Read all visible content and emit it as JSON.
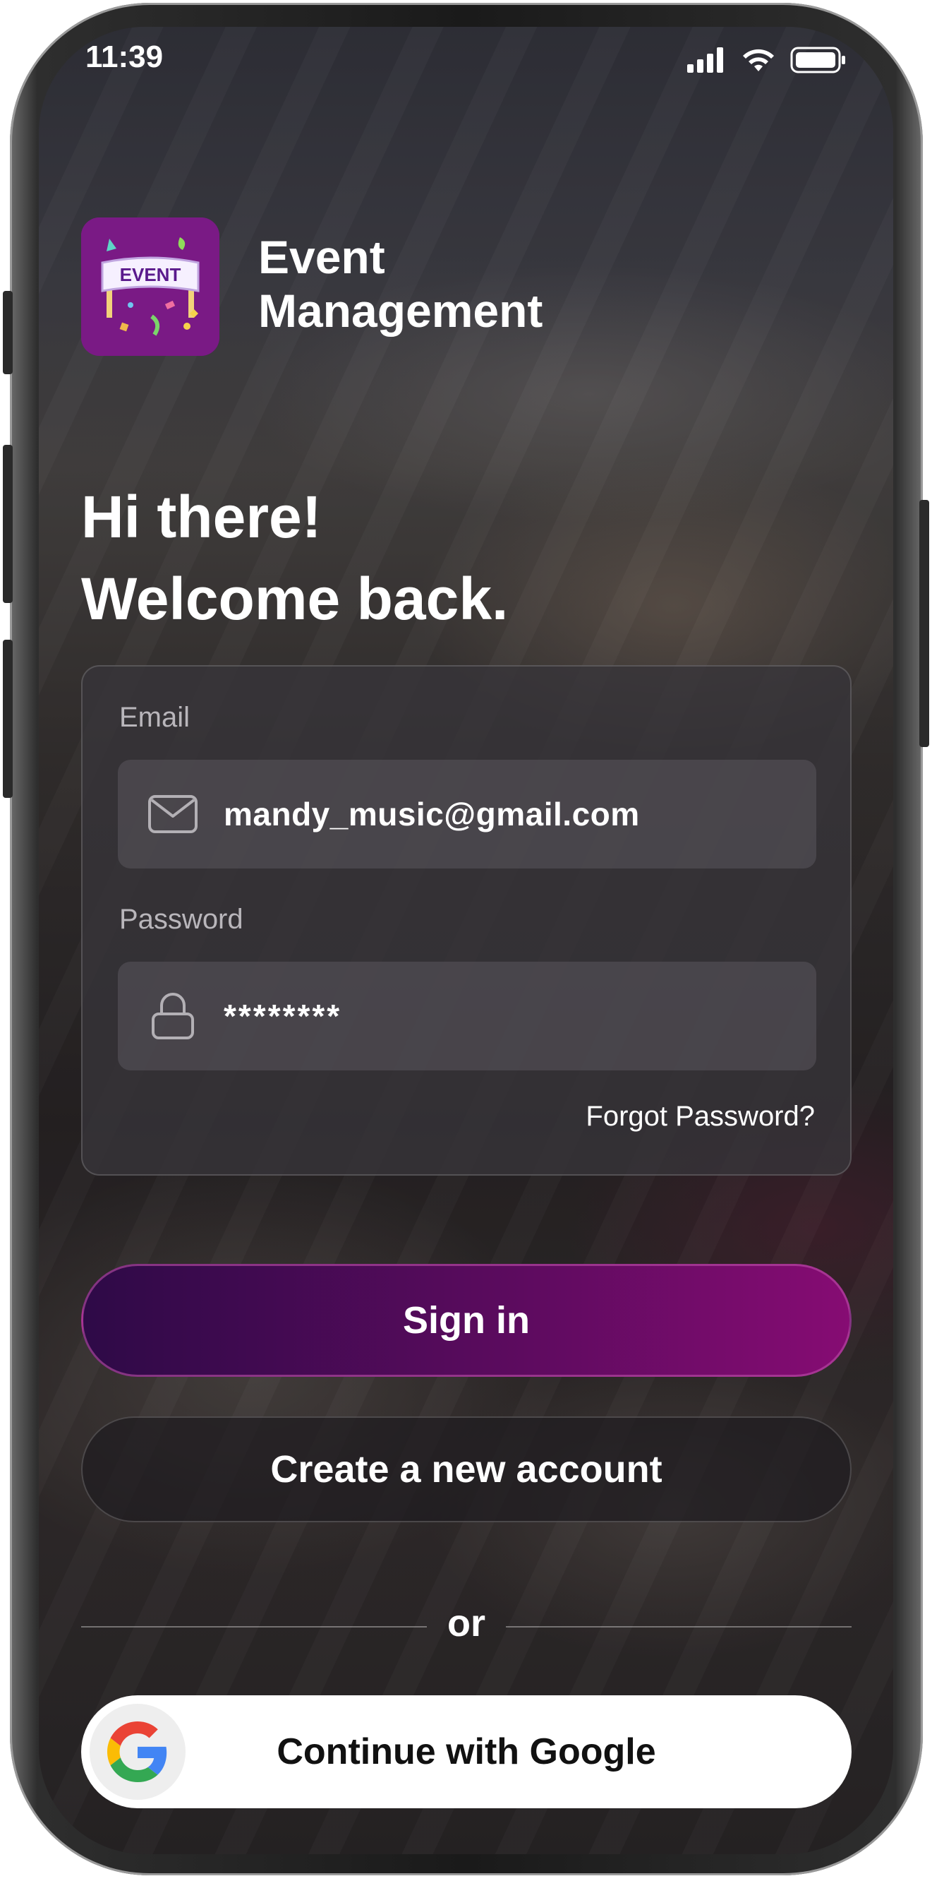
{
  "status_bar": {
    "time": "11:39"
  },
  "app": {
    "name_line1": "Event",
    "name_line2": "Management",
    "logo_text": "EVENT"
  },
  "greeting": {
    "line1": "Hi there!",
    "line2": "Welcome back."
  },
  "form": {
    "email_label": "Email",
    "email_value": "mandy_music@gmail.com",
    "password_label": "Password",
    "password_value": "********",
    "forgot_link": "Forgot Password?"
  },
  "buttons": {
    "signin": "Sign in",
    "create_account": "Create a new account",
    "divider": "or",
    "google": "Continue with Google"
  },
  "colors": {
    "accent_start": "#2e0a47",
    "accent_end": "#860c73",
    "logo_bg": "#8a1f8c",
    "text": "#ffffff"
  },
  "icons": [
    "signal-icon",
    "wifi-icon",
    "battery-icon",
    "mail-icon",
    "lock-icon",
    "google-icon"
  ]
}
